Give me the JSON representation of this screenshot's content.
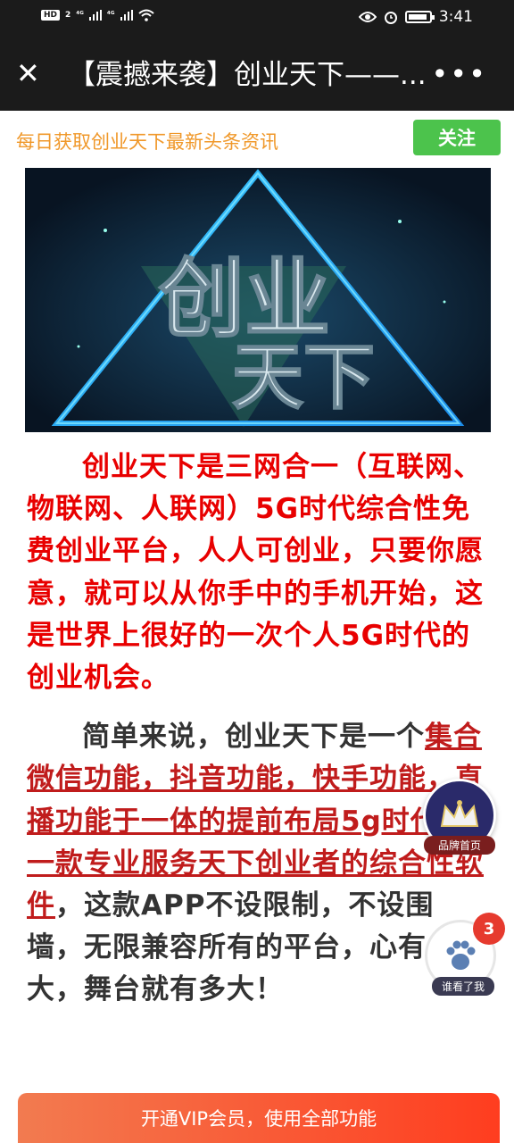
{
  "status_bar": {
    "hd": "HD",
    "sim": "2",
    "signal1": "⁴ᴳ",
    "signal2": "⁴ᴳ",
    "time": "3:41"
  },
  "nav": {
    "close_icon": "close-icon",
    "title": "【震撼来袭】创业天下——...",
    "more_icon": "more-icon"
  },
  "follow": {
    "text": "每日获取创业天下最新头条资讯",
    "button": "关注"
  },
  "banner": {
    "line1": "创业",
    "line2": "天下"
  },
  "article": {
    "para1": "创业天下是三网合一（互联网、物联网、人联网）5G时代综合性免费创业平台，人人可创业，只要你愿意，就可以从你手中的手机开始，这是世界上很好的一次个人5G时代的创业机会。",
    "para2_lead": "简单来说，创业天下是一个",
    "para2_link": "集合微信功能，抖音功能，快手功能，直播功能于一体的提前布局5g时代的一款专业服务天下创业者的综合性软件",
    "para2_tail": "，这款APP不设限制，不设围墙，无限兼容所有的平台，心有多大，舞台就有多大！"
  },
  "floating": {
    "brand_label": "品牌首页",
    "viewed_label": "谁看了我",
    "viewed_badge": "3"
  },
  "vip_bar": {
    "text": "开通VIP会员，使用全部功能"
  },
  "colors": {
    "accent_red": "#e80000",
    "follow_green": "#4cc34c",
    "follow_orange": "#f0982a",
    "vip_orange": "#ff3d1f"
  }
}
